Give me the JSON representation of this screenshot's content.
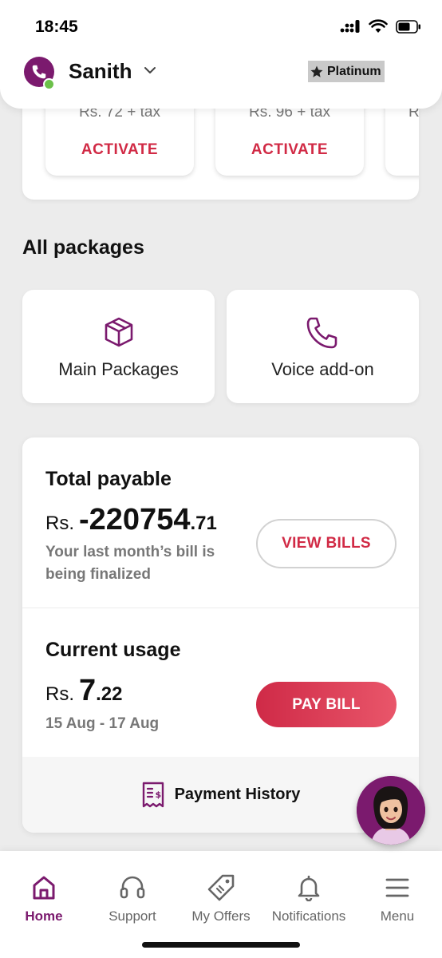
{
  "status_bar": {
    "time": "18:45"
  },
  "header": {
    "user_name": "Sanith",
    "tier": "Platinum"
  },
  "offers": [
    {
      "price": "Rs. 72 + tax",
      "action": "ACTIVATE"
    },
    {
      "price": "Rs. 96 + tax",
      "action": "ACTIVATE"
    },
    {
      "price": "R"
    }
  ],
  "packages": {
    "title": "All packages",
    "items": [
      {
        "label": "Main Packages",
        "icon": "box-icon"
      },
      {
        "label": "Voice add-on",
        "icon": "phone-icon"
      }
    ]
  },
  "bill": {
    "total_title": "Total payable",
    "total_currency": "Rs.",
    "total_whole": "-220754",
    "total_decimal": ".71",
    "total_note": "Your last month’s bill is being finalized",
    "view_bills_label": "VIEW BILLS",
    "usage_title": "Current usage",
    "usage_currency": "Rs.",
    "usage_whole": "7",
    "usage_decimal": ".22",
    "usage_period": "15 Aug - 17 Aug",
    "pay_bill_label": "PAY BILL",
    "history_label": "Payment History"
  },
  "nav": [
    {
      "label": "Home",
      "icon": "home-icon",
      "active": true
    },
    {
      "label": "Support",
      "icon": "headset-icon",
      "active": false
    },
    {
      "label": "My Offers",
      "icon": "tag-icon",
      "active": false
    },
    {
      "label": "Notifications",
      "icon": "bell-icon",
      "active": false
    },
    {
      "label": "Menu",
      "icon": "menu-icon",
      "active": false
    }
  ],
  "colors": {
    "brand": "#7b1a6e",
    "accent": "#d12a45",
    "online": "#6cc04a"
  }
}
